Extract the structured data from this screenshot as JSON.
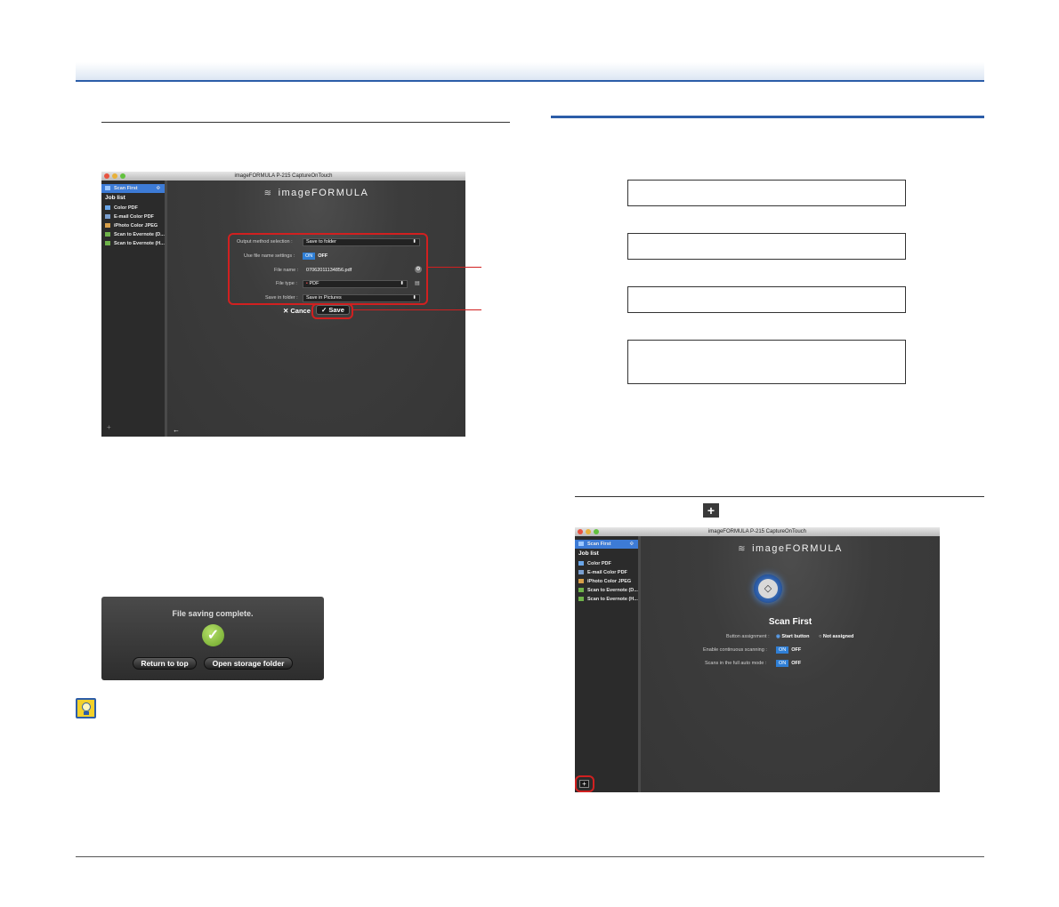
{
  "screen1": {
    "window_title": "imageFORMULA P-215 CaptureOnTouch",
    "sidebar": {
      "selected": "Scan First",
      "header": "Job list",
      "items": [
        "Color PDF",
        "E-mail Color PDF",
        "iPhoto Color JPEG",
        "Scan to Evernote (D...",
        "Scan to Evernote (H..."
      ],
      "add_glyph": "+"
    },
    "brand": "imageFORMULA",
    "form": {
      "output_label": "Output method selection :",
      "output_value": "Save to folder",
      "usefile_label": "Use file name settings :",
      "on_label": "ON",
      "off_label": "OFF",
      "filename_label": "File name :",
      "filename_value": "07062011134856.pdf",
      "filetype_label": "File type :",
      "filetype_value": "PDF",
      "savein_label": "Save in folder :",
      "savein_value": "Save in Pictures"
    },
    "cancel_label": "Cance",
    "save_label": "Save",
    "back_glyph": "←"
  },
  "dialog": {
    "message": "File saving complete.",
    "return_label": "Return to top",
    "open_label": "Open storage folder"
  },
  "plus_icon_glyph": "+",
  "screen2": {
    "window_title": "imageFORMULA P-215 CaptureOnTouch",
    "sidebar": {
      "selected": "Scan First",
      "header": "Job list",
      "items": [
        "Color PDF",
        "E-mail Color PDF",
        "iPhoto Color JPEG",
        "Scan to Evernote (D...",
        "Scan to Evernote (H..."
      ],
      "add_glyph": "+"
    },
    "brand": "imageFORMULA",
    "job_title": "Scan First",
    "button_assignment_label": "Button assignment :",
    "start_button_label": "Start button",
    "not_assigned_label": "Not assigned",
    "continuous_label": "Enable continuous scanning :",
    "fullauto_label": "Scans in the full auto mode :",
    "on_label": "ON",
    "off_label": "OFF"
  },
  "colors": {
    "accent_blue": "#2c5da8",
    "highlight_red": "#d12020",
    "toggle_blue": "#2f7fd6"
  }
}
